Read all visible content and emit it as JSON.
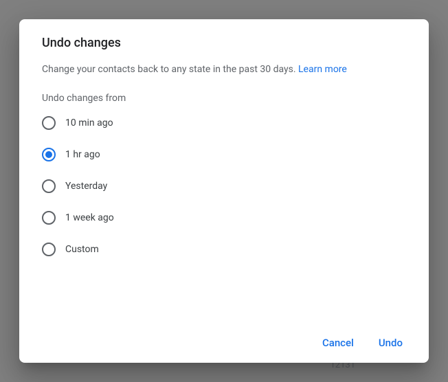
{
  "dialog": {
    "title": "Undo changes",
    "description": "Change your contacts back to any state in the past 30 days. ",
    "learn_more": "Learn more",
    "form_label": "Undo changes from",
    "options": [
      {
        "label": "10 min ago",
        "selected": false
      },
      {
        "label": "1 hr ago",
        "selected": true
      },
      {
        "label": "Yesterday",
        "selected": false
      },
      {
        "label": "1 week ago",
        "selected": false
      },
      {
        "label": "Custom",
        "selected": false
      }
    ],
    "actions": {
      "cancel": "Cancel",
      "confirm": "Undo"
    }
  },
  "backdrop": {
    "partial_text": "12131"
  }
}
